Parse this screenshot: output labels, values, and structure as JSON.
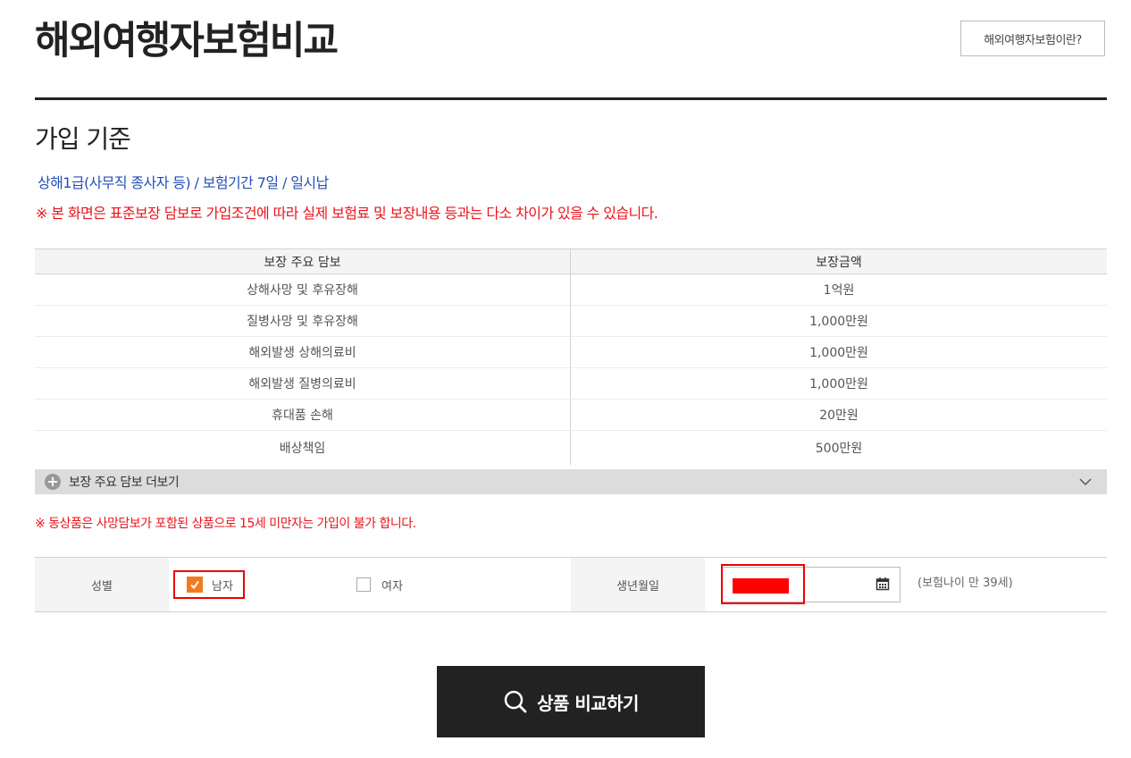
{
  "header": {
    "title": "해외여행자보험비교",
    "about_button": "해외여행자보험이란?"
  },
  "criteria": {
    "section_title": "가입 기준",
    "subtitle": "상해1급(사무직 종사자 등) / 보험기간 7일 / 일시납",
    "notice": "※ 본 화면은 표준보장 담보로 가입조건에 따라 실제 보험료 및 보장내용 등과는 다소 차이가 있을 수 있습니다."
  },
  "coverage_table": {
    "headers": [
      "보장 주요 담보",
      "보장금액"
    ],
    "rows": [
      {
        "item": "상해사망 및 후유장해",
        "amount": "1억원"
      },
      {
        "item": "질병사망 및 후유장해",
        "amount": "1,000만원"
      },
      {
        "item": "해외발생 상해의료비",
        "amount": "1,000만원"
      },
      {
        "item": "해외발생 질병의료비",
        "amount": "1,000만원"
      },
      {
        "item": "휴대품 손해",
        "amount": "20만원"
      },
      {
        "item": "배상책임",
        "amount": "500만원"
      }
    ],
    "more_label": "보장 주요 담보 더보기"
  },
  "warning": "※ 동상품은 사망담보가 포함된 상품으로 15세 미만자는 가입이 불가 합니다.",
  "form": {
    "gender_label": "성별",
    "gender_options": [
      {
        "label": "남자",
        "checked": true
      },
      {
        "label": "여자",
        "checked": false
      }
    ],
    "birth_label": "생년월일",
    "age_note": "(보험나이 만  39세)"
  },
  "compare_button": "상품 비교하기",
  "colors": {
    "accent_checkbox": "#f47a20",
    "notice_red": "#e8141b",
    "criteria_blue": "#2350b8",
    "button_dark": "#222222"
  },
  "icons": {
    "more": "plus-circle-icon",
    "expand": "chevron-down-icon",
    "calendar": "calendar-icon",
    "search": "search-icon",
    "check": "check-icon"
  }
}
